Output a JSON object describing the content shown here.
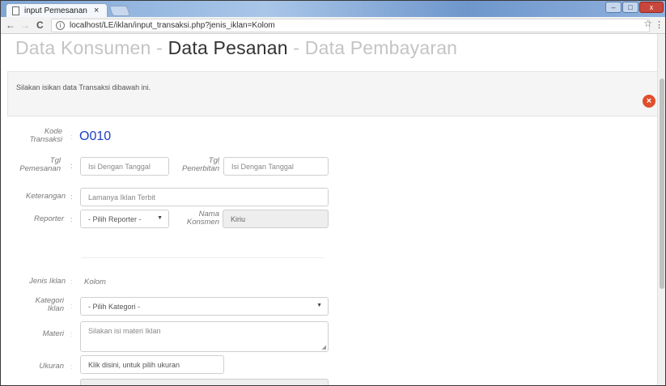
{
  "browser": {
    "tab_title": "input Pemesanan",
    "tab_close": "×",
    "url": "localhost/LE/iklan/input_transaksi.php?jenis_iklan=Kolom",
    "back": "←",
    "forward": "→",
    "reload": "C",
    "info": "i",
    "star": "☆",
    "menu": "⋮",
    "window_buttons": {
      "minimize": "–",
      "maximize": "□",
      "close": "x"
    }
  },
  "steps": {
    "step1": "Data Konsumen",
    "sep1": " - ",
    "step2": "Data Pesanan",
    "sep2": " - ",
    "step3": "Data Pembayaran"
  },
  "info_panel": {
    "text": "Silakan isikan data Transaksi dibawah ini.",
    "close_symbol": "×"
  },
  "form": {
    "colon": ":",
    "kode_label": "Kode\nTransaksi",
    "kode_value": "O010",
    "tgl_pemesanan_label": "Tgl\nPemesanan",
    "tgl_pemesanan_placeholder": "Isi Dengan Tanggal",
    "tgl_penerbitan_label": "Tgl\nPenerbitan",
    "tgl_penerbitan_placeholder": "Isi Dengan Tanggal",
    "keterangan_label": "Keterangan",
    "keterangan_placeholder": "Lamanya Iklan Terbit",
    "reporter_label": "Reporter",
    "reporter_selected": "- Pilih Reporter -",
    "nama_konsumen_label": "Nama\nKonsmen",
    "nama_konsumen_value": "Kiriu",
    "jenis_iklan_label": "Jenis Iklan",
    "jenis_iklan_value": "Kolom",
    "kategori_label": "Kategori\nIklan",
    "kategori_selected": "- Pilih Kategori -",
    "materi_label": "Materi",
    "materi_placeholder": "Silakan isi materi Iklan",
    "ukuran_label": "Ukuran",
    "ukuran_placeholder": "Klik disini, untuk pilih ukuran",
    "select_arrow": "▼",
    "resize_glyph": "◢"
  }
}
